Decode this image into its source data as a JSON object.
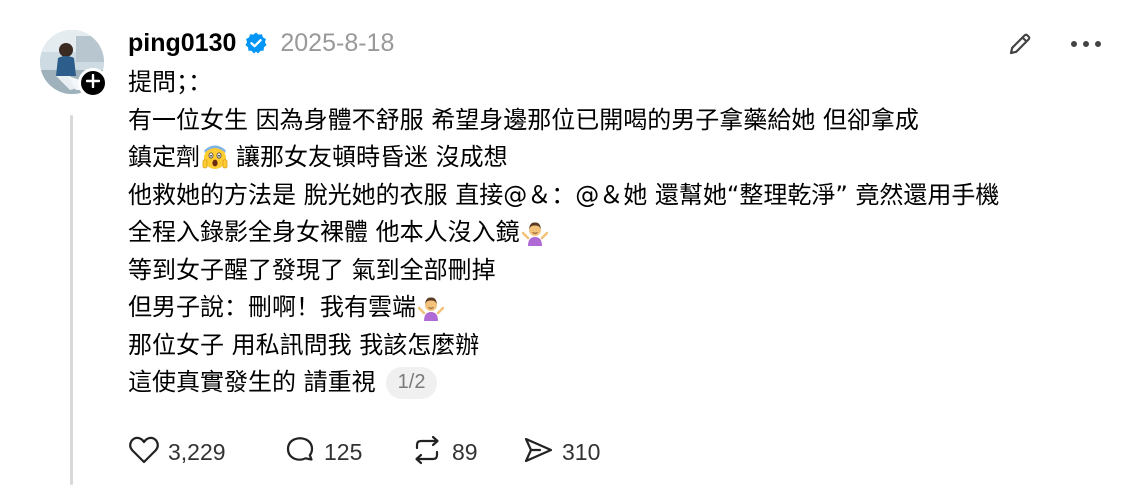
{
  "post": {
    "username": "ping0130",
    "date": "2025-8-18",
    "lines": [
      "提問；：",
      "有一位女生 因為身體不舒服 希望身邊那位已開喝的男子拿藥給她 但卻拿成",
      "鎮定劑",
      "讓那女友頓時昏迷 沒成想",
      "他救她的方法是 脫光她的衣服 直接@＆：@＆她 還幫她“整理乾淨” 竟然還用手機",
      "全程入錄影全身女裸體 他本人沒入鏡",
      "等到女子醒了發現了 氣到全部刪掉",
      "但男子說：刪啊！我有雲端",
      "那位女子 用私訊問我 我該怎麼辦",
      "這使真實發生的 請重視"
    ],
    "page_indicator": "1/2"
  },
  "actions": {
    "likes": "3,229",
    "replies": "125",
    "reposts": "89",
    "shares": "310"
  },
  "icons": {
    "verified": "verified-badge-icon",
    "edit": "pencil-icon",
    "more": "more-horizontal-icon",
    "follow": "plus-icon",
    "like": "heart-icon",
    "reply": "comment-bubble-icon",
    "repost": "repost-icon",
    "share": "send-icon",
    "emoji_scream": "face-screaming-emoji",
    "emoji_shrug": "person-shrugging-emoji"
  },
  "colors": {
    "verified_blue": "#0095f6",
    "muted_text": "#999999",
    "thread_line": "#d9d9d9"
  }
}
